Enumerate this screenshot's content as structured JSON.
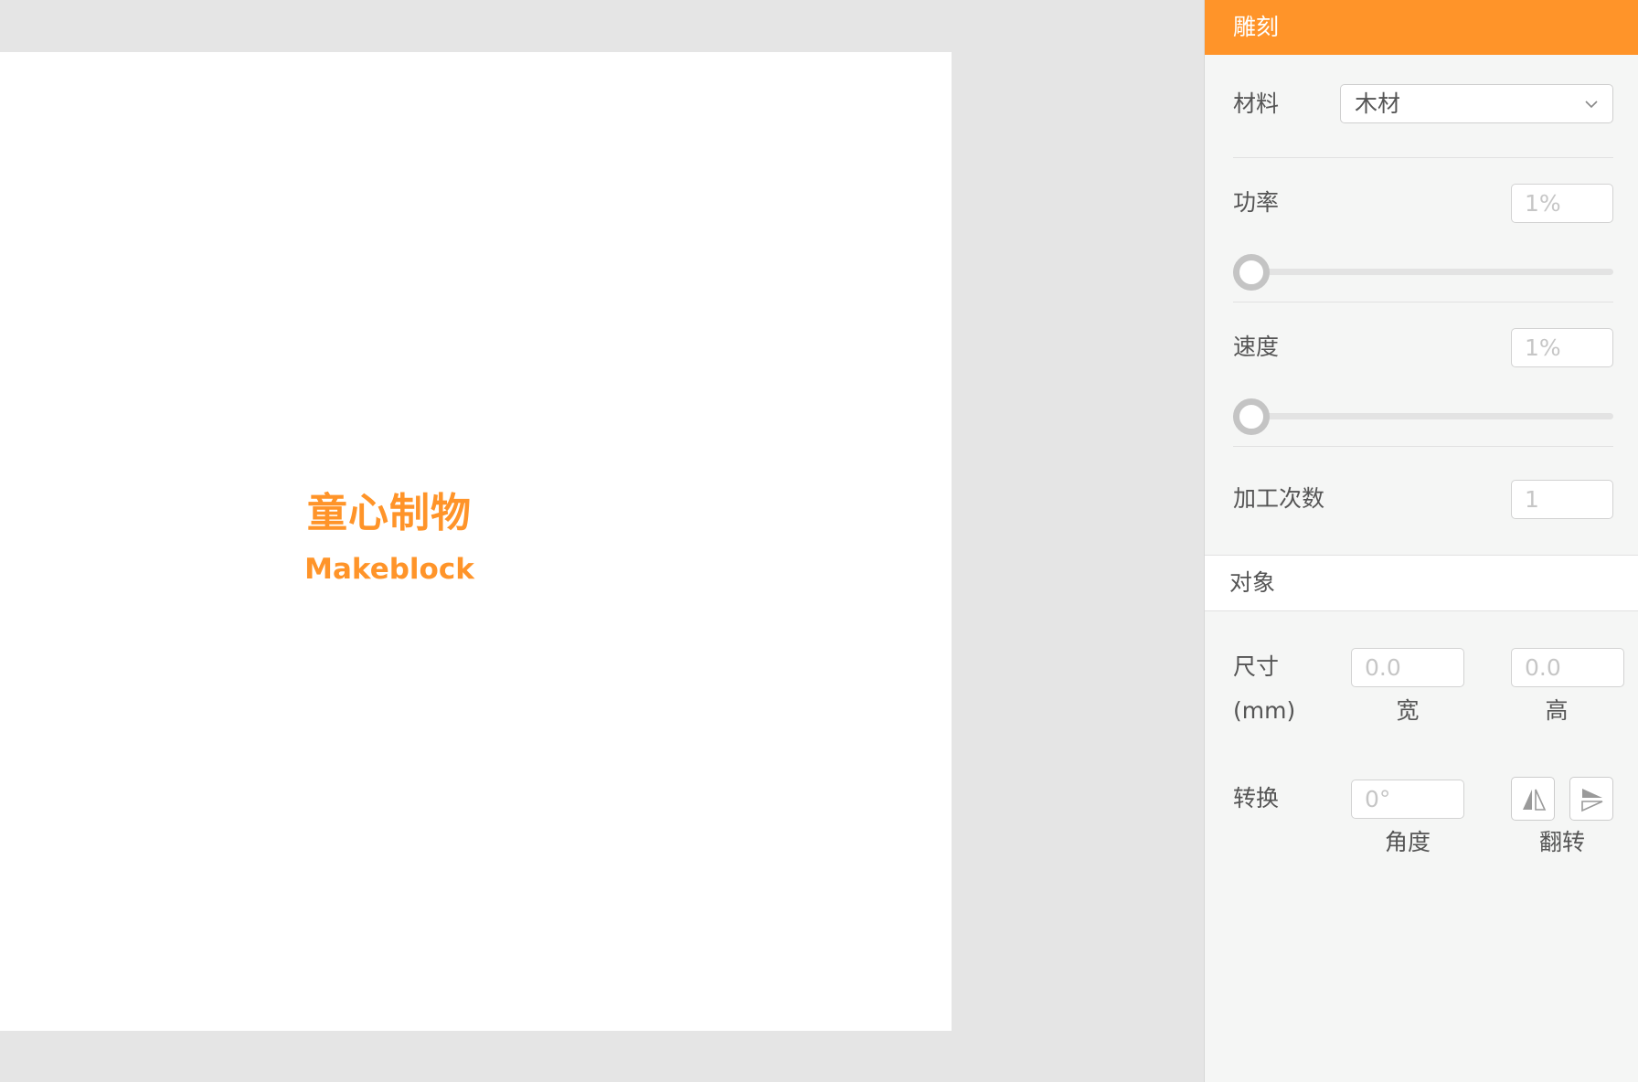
{
  "canvas": {
    "logo_line1": "童心制物",
    "logo_line2": "Makeblock"
  },
  "panel": {
    "title": "雕刻",
    "material": {
      "label": "材料",
      "value": "木材"
    },
    "power": {
      "label": "功率",
      "placeholder": "1%",
      "level_percent": 1
    },
    "speed": {
      "label": "速度",
      "placeholder": "1%",
      "level_percent": 1
    },
    "passes": {
      "label": "加工次数",
      "placeholder": "1"
    },
    "object": {
      "title": "对象",
      "size": {
        "label": "尺寸",
        "unit": "(mm)",
        "width_placeholder": "0.0",
        "width_caption": "宽",
        "height_placeholder": "0.0",
        "height_caption": "高"
      },
      "transform": {
        "label": "转换",
        "angle_placeholder": "0°",
        "angle_caption": "角度",
        "flip_caption": "翻转"
      }
    }
  },
  "colors": {
    "accent": "#ff9429",
    "panel_bg": "#f5f6f5",
    "workspace_bg": "#e5e5e5"
  },
  "icons": {
    "material_dropdown": "chevron-down-icon",
    "flip_horizontal": "flip-horizontal-icon",
    "flip_vertical": "flip-vertical-icon"
  }
}
